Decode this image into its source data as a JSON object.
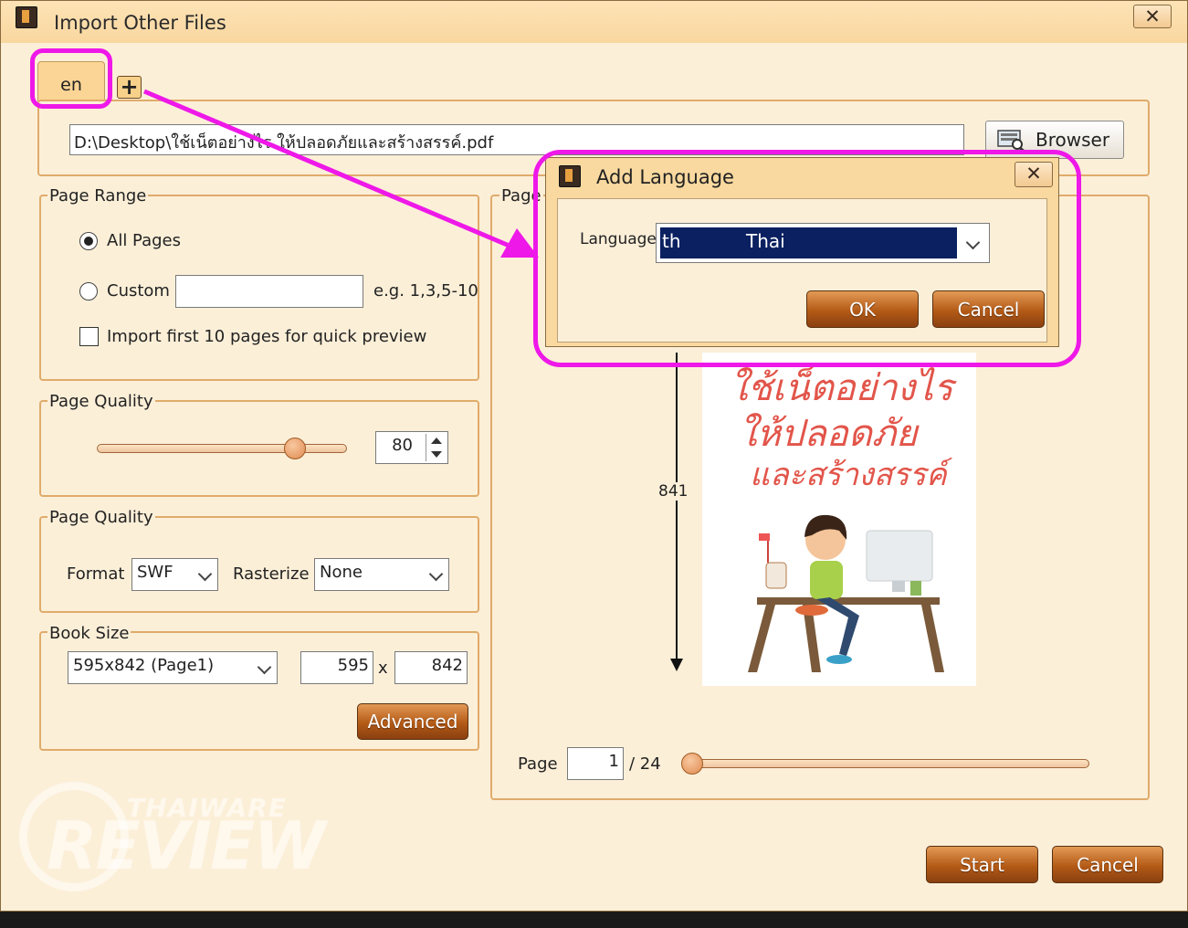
{
  "window": {
    "title": "Import Other Files",
    "close_glyph": "✕"
  },
  "tabs": {
    "active": "en",
    "add_glyph": "+"
  },
  "file_path": "D:\\Desktop\\ใช้เน็ตอย่างไร ให้ปลอดภัยและสร้างสรรค์.pdf",
  "browser_button": "Browser",
  "page_range": {
    "label": "Page Range",
    "all_pages": "All Pages",
    "custom": "Custom",
    "custom_value": "",
    "example": "e.g. 1,3,5-10",
    "quick_preview": "Import first 10 pages for quick preview"
  },
  "page_quality": {
    "label": "Page Quality",
    "value": "80",
    "slider_fraction": 0.82
  },
  "output": {
    "label": "Page Quality",
    "format_label": "Format",
    "format_value": "SWF",
    "rasterize_label": "Rasterize",
    "rasterize_value": "None"
  },
  "book_size": {
    "label": "Book Size",
    "preset": "595x842 (Page1)",
    "width": "595",
    "x": "x",
    "height": "842",
    "advanced": "Advanced"
  },
  "preview": {
    "label": "Page",
    "height_marker": "841",
    "page_label": "Page",
    "page_value": "1",
    "page_total": "/ 24",
    "page_fraction": 0.0,
    "thumb_text": [
      "ใช้เน็ตอย่างไร",
      "ให้ปลอดภัย",
      "และสร้างสรรค์"
    ]
  },
  "dialog": {
    "title": "Add Language",
    "language_label": "Language",
    "lang_code": "th",
    "lang_name": "Thai",
    "ok": "OK",
    "cancel": "Cancel",
    "close_glyph": "✕"
  },
  "footer": {
    "start": "Start",
    "cancel": "Cancel"
  },
  "watermark": {
    "brand": "THAIWARE",
    "product": "REVIEW"
  },
  "colors": {
    "highlight": "#ee18e8",
    "accent_button": "#b35a16",
    "selection": "#0a2060",
    "group_border": "#e0ab6b"
  }
}
